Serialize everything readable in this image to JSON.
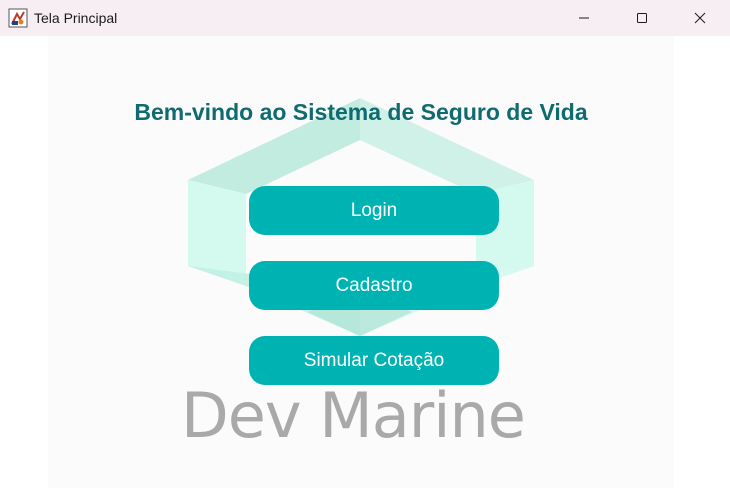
{
  "window": {
    "title": "Tela Principal",
    "controls": {
      "minimize_icon": "minimize-icon",
      "maximize_icon": "maximize-icon",
      "close_icon": "close-icon"
    }
  },
  "main": {
    "heading": "Bem-vindo ao Sistema de Seguro de Vida",
    "buttons": [
      {
        "label": "Login"
      },
      {
        "label": "Cadastro"
      },
      {
        "label": "Simular Cotação"
      }
    ],
    "logo_text": "Dev Marine"
  },
  "colors": {
    "heading": "#0f6b70",
    "button_bg": "#00b3b3",
    "button_text": "#ffffff",
    "logo_text": "#a9a9a9",
    "titlebar_bg": "#f7eef3",
    "content_bg": "#fbfbfb",
    "art_light": "#d4fbf1",
    "art_mid": "#b3e6da"
  }
}
